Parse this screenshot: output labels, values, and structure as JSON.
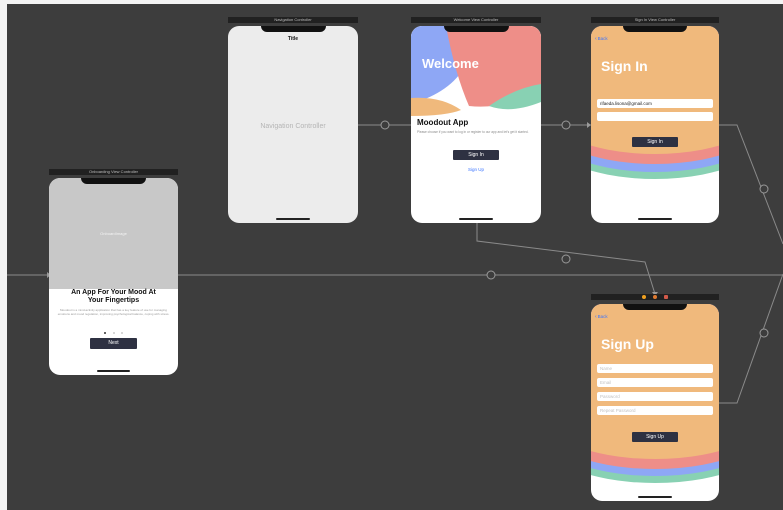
{
  "scenes": {
    "onboarding": {
      "bar_title": "Onboarding View Controller",
      "image_label": "OnboardImage",
      "heading": "An App For Your Mood At Your Fingertips",
      "body": "Moodout is a mind-activity application that has a key feature of use for managing emotions and mood regulation, improving psychological balance, coping with stress.",
      "next_label": "Next"
    },
    "navigation": {
      "bar_title": "Navigation Controller",
      "nav_title": "Title",
      "center_label": "Navigation Controller"
    },
    "welcome": {
      "bar_title": "Welcome View Controller",
      "hero_title": "Welcome",
      "app_name": "Moodout App",
      "description": "Please choose if you want to log in or register to our app and let's get it started.",
      "sign_in_label": "Sign In",
      "sign_up_label": "Sign Up"
    },
    "sign_in": {
      "bar_title": "Sign In View Controller",
      "back_label": "Back",
      "title": "Sign In",
      "email_value": "rifaeda.lisona@gmail.com",
      "button_label": "Sign In"
    },
    "sign_up": {
      "back_label": "Back",
      "title": "Sign Up",
      "name_placeholder": "Name",
      "email_placeholder": "Email",
      "password_placeholder": "Password",
      "repeat_password_placeholder": "Repeat Password",
      "button_label": "Sign Up"
    }
  },
  "icons": {
    "segue": "segue-icon",
    "back": "chevron-left-icon",
    "scene_dock": [
      "view-controller-icon",
      "first-responder-icon",
      "exit-icon"
    ]
  },
  "colors": {
    "canvas": "#3d3d3d",
    "scene_bar": "#212121",
    "orange": "#f0b97c",
    "coral": "#ee8e88",
    "blue": "#8ea7f5",
    "green": "#88d1b3",
    "button_dark": "#2e3142",
    "link_blue": "#3b74ff",
    "nav_gray": "#ececec"
  }
}
